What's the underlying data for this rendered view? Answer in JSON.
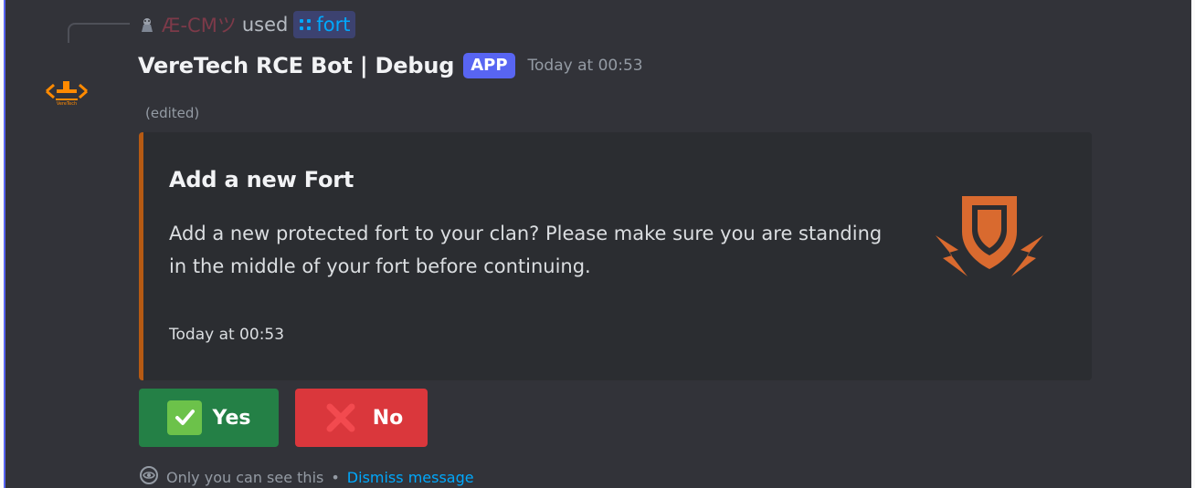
{
  "reply": {
    "user": "Æ-CMツ",
    "verb": "used",
    "command": "fort"
  },
  "message": {
    "bot_name": "VereTech RCE Bot | Debug",
    "badge": "APP",
    "timestamp": "Today at 00:53",
    "edited": "(edited)"
  },
  "embed": {
    "title": "Add a new Fort",
    "description": "Add a new protected fort to your clan? Please make sure you are standing in the middle of your fort before continuing.",
    "footer": "Today at 00:53",
    "accent_color": "#b65a13",
    "thumbnail_icon": "shield-lightning-icon"
  },
  "buttons": {
    "yes": {
      "label": "Yes",
      "icon": "check-icon"
    },
    "no": {
      "label": "No",
      "icon": "cross-icon"
    }
  },
  "ephemeral": {
    "text": "Only you can see this",
    "separator": "•",
    "dismiss": "Dismiss message"
  },
  "colors": {
    "background": "#323339",
    "embed_background": "#2b2d31",
    "app_badge": "#5865f2",
    "yes_button": "#248046",
    "no_button": "#da373c",
    "link": "#00a8fc"
  }
}
